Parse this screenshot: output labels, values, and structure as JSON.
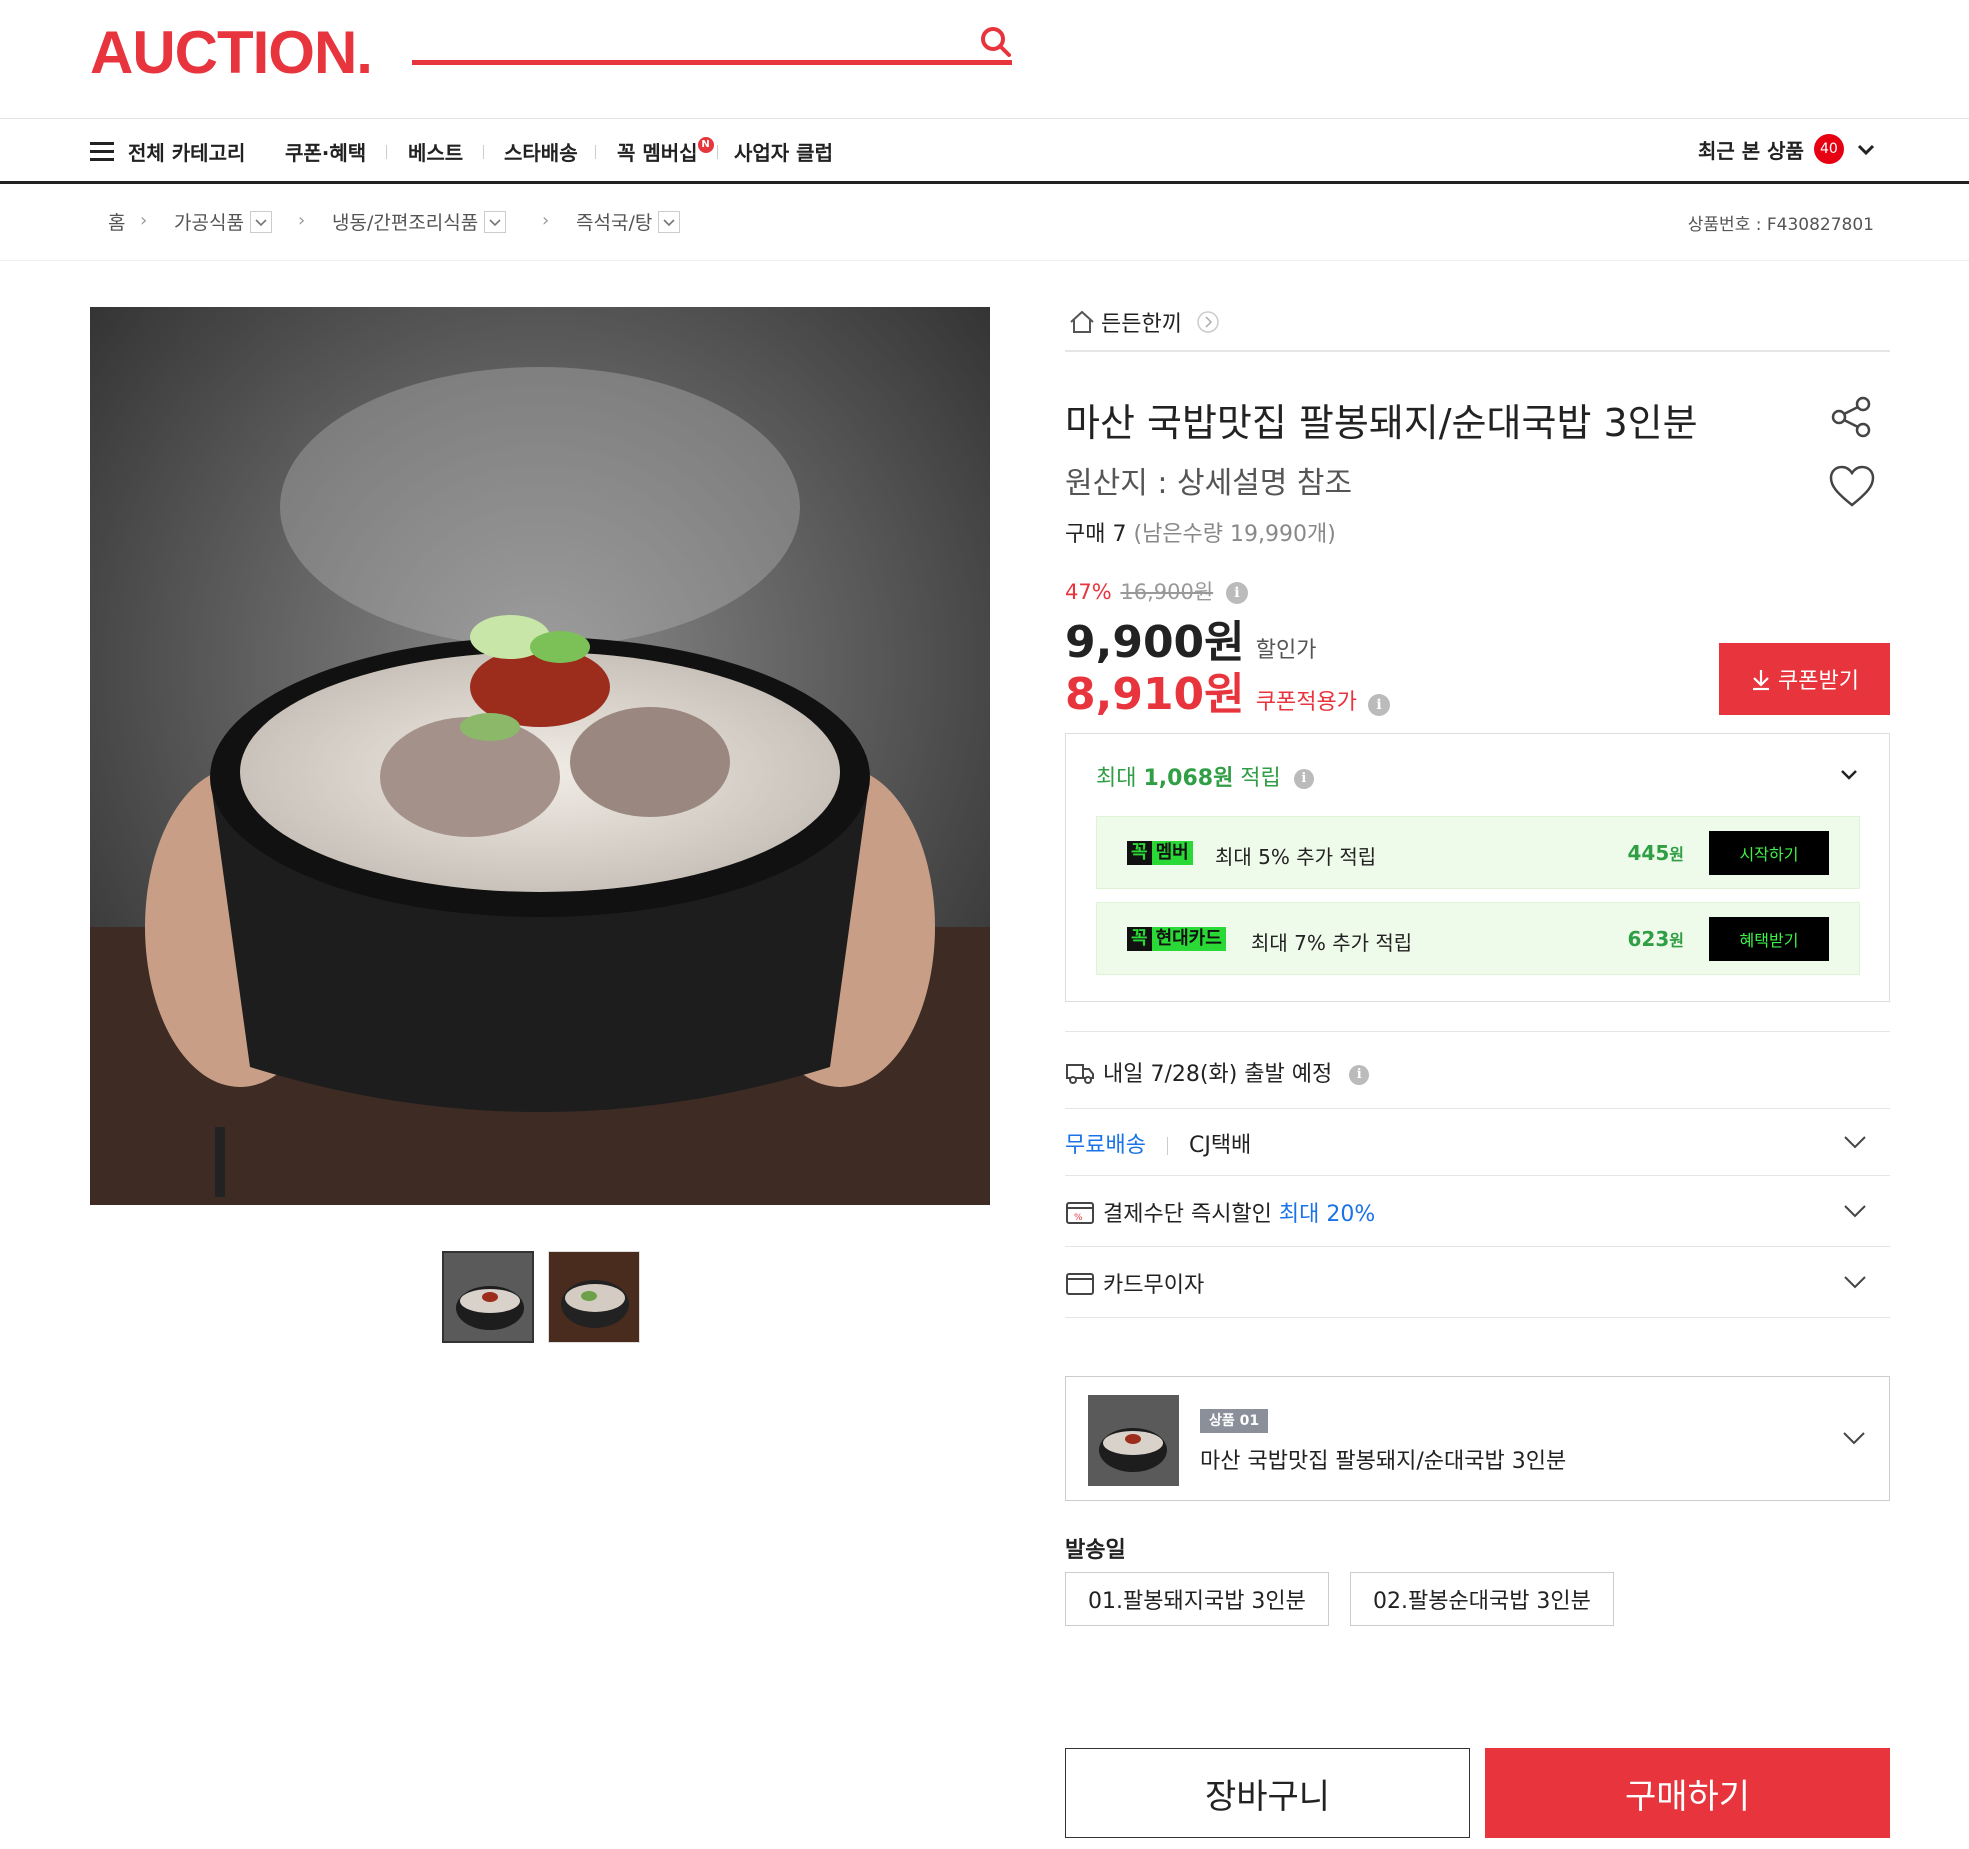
{
  "header": {
    "logo": "AUCTION."
  },
  "gnb": {
    "all_category": "전체 카테고리",
    "items": [
      "쿠폰·혜택",
      "베스트",
      "스타배송",
      "꼭 멤버십",
      "사업자 클럽"
    ],
    "new_badge": "N",
    "recent": "최근 본 상품",
    "recent_count": "40"
  },
  "breadcrumb": {
    "home": "홈",
    "items": [
      "가공식품",
      "냉동/간편조리식품",
      "즉석국/탕"
    ],
    "product_no": "상품번호 : F430827801"
  },
  "product": {
    "store": "든든한끼",
    "title": "마산 국밥맛집 팔봉돼지/순대국밥 3인분",
    "origin": "원산지 : 상세설명 참조",
    "purchase_label": "구매 7",
    "remaining": "(남은수량 19,990개)",
    "discount_rate": "47%",
    "original_price": "16,900원",
    "sale_price": "9,900원",
    "sale_label": "할인가",
    "coupon_price": "8,910원",
    "coupon_label": "쿠폰적용가",
    "coupon_button": "쿠폰받기"
  },
  "points": {
    "head_prefix": "최대 ",
    "head_amount": "1,068원",
    "head_suffix": " 적립",
    "rows": [
      {
        "badge_a": "꼭",
        "badge_b": "멤버",
        "text": "최대 5% 추가 적립",
        "amount": "445",
        "unit": "원",
        "button": "시작하기"
      },
      {
        "badge_a": "꼭",
        "badge_b": "현대카드",
        "text": "최대 7% 추가 적립",
        "amount": "623",
        "unit": "원",
        "button": "혜택받기"
      }
    ]
  },
  "delivery": {
    "schedule": "내일 7/28(화) 출발 예정",
    "free": "무료배송",
    "carrier": "CJ택배",
    "payment_label": "결제수단 즉시할인",
    "payment_highlight": "최대 20%",
    "installment": "카드무이자"
  },
  "option": {
    "badge": "상품 01",
    "name": "마산 국밥맛집 팔봉돼지/순대국밥 3인분",
    "ship_label": "발송일",
    "choices": [
      "01.팔봉돼지국밥 3인분",
      "02.팔봉순대국밥 3인분"
    ]
  },
  "actions": {
    "cart": "장바구니",
    "buy": "구매하기"
  },
  "colors": {
    "brand": "#e8343c",
    "green": "#2f9e44",
    "blue": "#1a73e8"
  }
}
